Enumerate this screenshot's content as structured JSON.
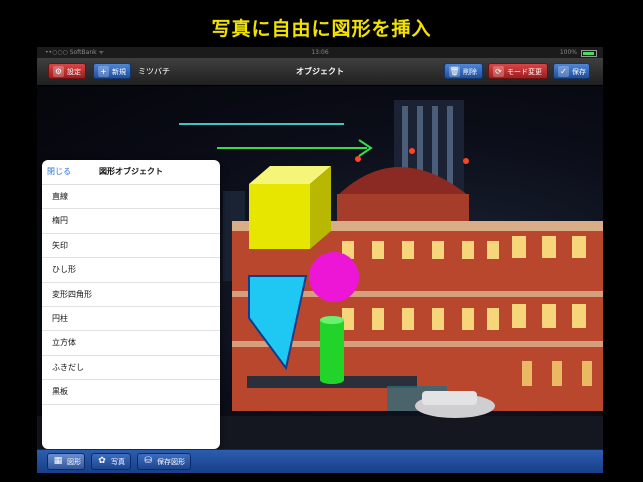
{
  "promo_title": "写真に自由に図形を挿入",
  "status": {
    "carrier": "••○○○ SoftBank ᯤ",
    "time": "13:06",
    "battery": "100%"
  },
  "nav": {
    "settings": "設定",
    "new": "新規",
    "doc_name": "ミツバチ",
    "title": "オブジェクト",
    "delete": "削除",
    "mode_change": "モード変更",
    "save": "保存"
  },
  "popover": {
    "close": "閉じる",
    "title": "図形オブジェクト",
    "items": [
      "直線",
      "楕円",
      "矢印",
      "ひし形",
      "変形四角形",
      "円柱",
      "立方体",
      "ふきだし",
      "黒板"
    ]
  },
  "bottom": {
    "shapes": "図形",
    "photo": "写真",
    "save_shape": "保存図形"
  },
  "colors": {
    "promo_text": "#f2e200",
    "line_cyan": "#3ec6c6",
    "arrow_green": "#3cd84a",
    "cube": "#e6e600",
    "circle": "#ee16d6",
    "trapezoid": "#1ec8f2",
    "cylinder": "#22d42a"
  }
}
